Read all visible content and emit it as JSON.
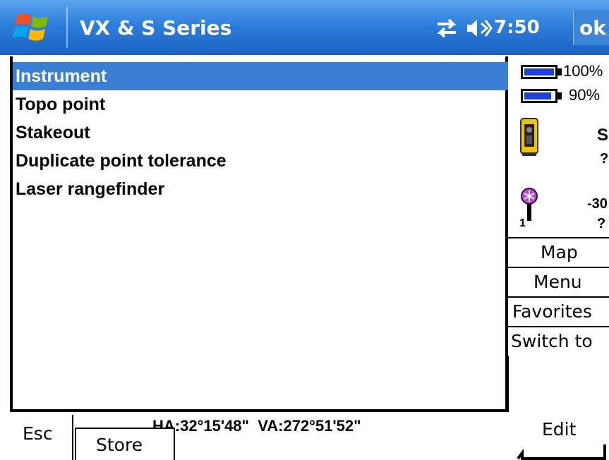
{
  "titlebar": {
    "title": "VX & S Series",
    "time": "7:50",
    "ok_label": "ok"
  },
  "list": {
    "items": [
      {
        "label": "Instrument",
        "selected": true
      },
      {
        "label": "Topo point",
        "selected": false
      },
      {
        "label": "Stakeout",
        "selected": false
      },
      {
        "label": "Duplicate point tolerance",
        "selected": false
      },
      {
        "label": "Laser rangefinder",
        "selected": false
      }
    ]
  },
  "status": {
    "battery1_pct": "100%",
    "battery1_level": 1.0,
    "battery2_pct": "90%",
    "battery2_level": 0.9,
    "instrument_label": "S",
    "instrument_value": "?",
    "target_label": "-30",
    "target_value": "?",
    "target_number": "1"
  },
  "right_buttons": {
    "map": "Map",
    "menu": "Menu",
    "favorites": "Favorites",
    "switch_to": "Switch to"
  },
  "bottom": {
    "esc": "Esc",
    "angles": "HA:32°15'48\"  VA:272°51'52\"",
    "store": "Store",
    "edit": "Edit"
  },
  "colors": {
    "titlebar": "#2d7fdc",
    "selection": "#3b7fd4",
    "battery_fill": "#1f3fe0"
  },
  "icons": {
    "start": "windows-flag-icon",
    "connectivity": "connectivity-arrows-icon",
    "volume": "speaker-icon",
    "instrument": "total-station-icon",
    "target": "prism-target-icon"
  }
}
